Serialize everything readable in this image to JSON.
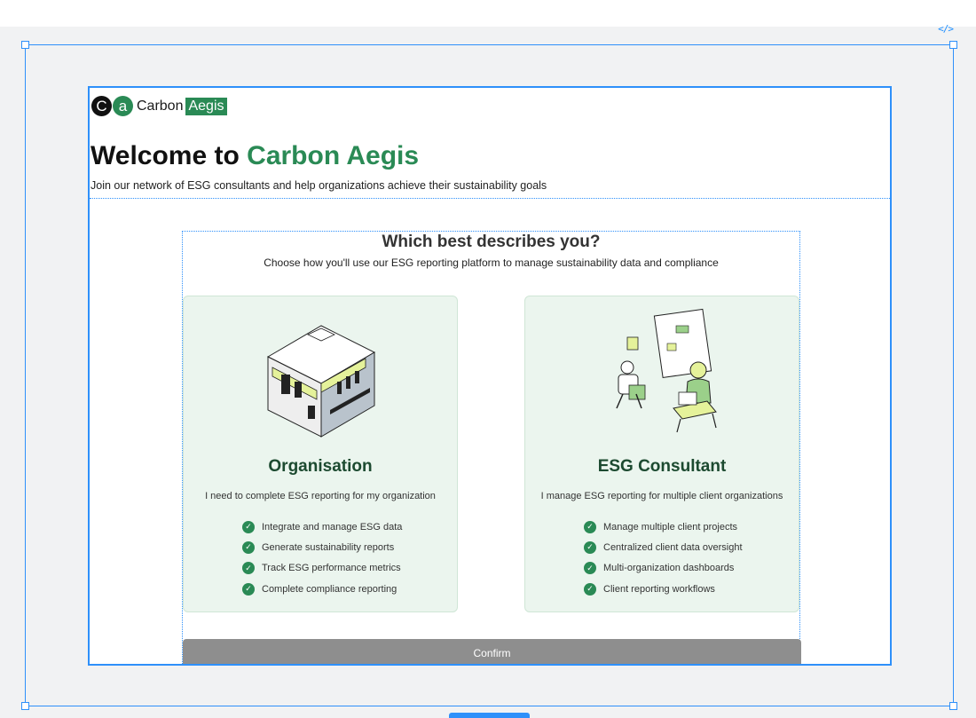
{
  "editor": {
    "code_toggle": "</>"
  },
  "logo": {
    "c": "C",
    "a": "a",
    "carbon": "Carbon",
    "aegis": "Aegis"
  },
  "header": {
    "welcome_prefix": "Welcome to ",
    "welcome_brand": "Carbon Aegis",
    "subtitle": "Join our network of ESG consultants and help organizations achieve their sustainability goals"
  },
  "selector": {
    "title": "Which best describes you?",
    "subtitle": "Choose how you'll use our ESG reporting platform to manage sustainability data and compliance",
    "cards": [
      {
        "title": "Organisation",
        "description": "I need to complete ESG reporting for my organization",
        "illustration": "building-illustration",
        "features": [
          "Integrate and manage ESG data",
          "Generate sustainability reports",
          "Track ESG performance metrics",
          "Complete compliance reporting"
        ]
      },
      {
        "title": "ESG Consultant",
        "description": "I manage ESG reporting for multiple client organizations",
        "illustration": "consultant-illustration",
        "features": [
          "Manage multiple client projects",
          "Centralized client data oversight",
          "Multi-organization dashboards",
          "Client reporting workflows"
        ]
      }
    ],
    "confirm_label": "Confirm"
  },
  "colors": {
    "brand_green": "#2a8a55",
    "card_bg": "#ebf5ee",
    "selection_blue": "#2e90fa",
    "confirm_disabled": "#8e8e8e"
  }
}
